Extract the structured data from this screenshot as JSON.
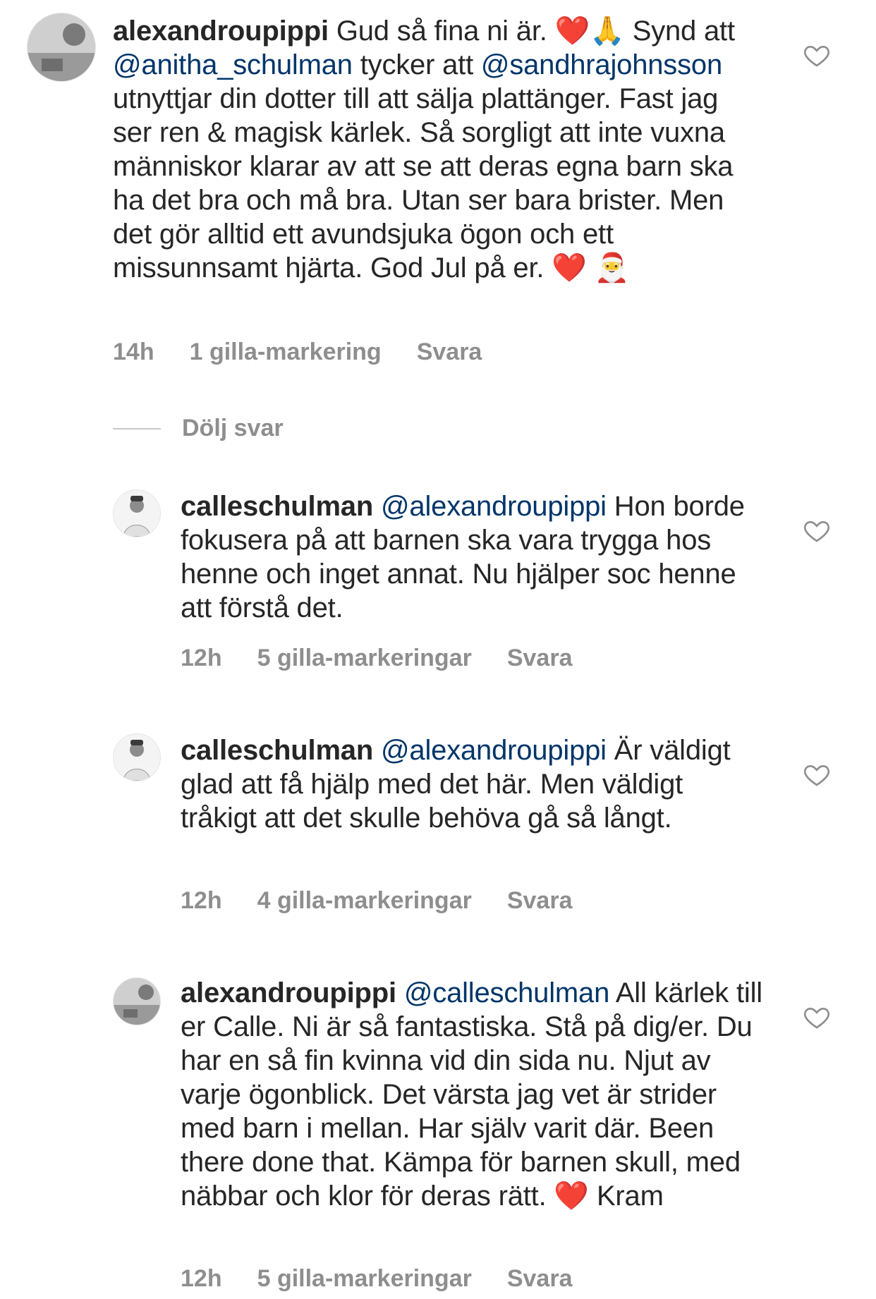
{
  "comments": [
    {
      "username": "alexandroupippi",
      "segments": [
        {
          "t": " Gud så fina ni är. "
        },
        {
          "t": "❤️",
          "emoji": true
        },
        {
          "t": "🙏",
          "emoji": true
        },
        {
          "t": " Synd att "
        },
        {
          "t": "@anitha_schulman",
          "mention": true
        },
        {
          "t": " tycker att "
        },
        {
          "t": "@sandhrajohnsson",
          "mention": true
        },
        {
          "t": " utnyttjar din dotter till att sälja plattänger. Fast jag ser ren & magisk kärlek. Så sorgligt att inte vuxna människor klarar av att se att deras egna barn ska ha det bra och må bra. Utan ser bara brister. Men det gör alltid ett avundsjuka ögon och ett missunnsamt hjärta. God Jul på er. "
        },
        {
          "t": "❤️",
          "emoji": true
        },
        {
          "t": " "
        },
        {
          "t": "🎅",
          "emoji": true
        }
      ],
      "time": "14h",
      "likes": "1 gilla-markering",
      "reply": "Svara"
    },
    {
      "username": "calleschulman",
      "segments": [
        {
          "t": " "
        },
        {
          "t": "@alexandroupippi",
          "mention": true
        },
        {
          "t": " Hon borde fokusera på att barnen ska vara trygga hos henne och inget annat. Nu hjälper soc henne att förstå det."
        }
      ],
      "time": "12h",
      "likes": "5 gilla-markeringar",
      "reply": "Svara"
    },
    {
      "username": "calleschulman",
      "segments": [
        {
          "t": " "
        },
        {
          "t": "@alexandroupippi",
          "mention": true
        },
        {
          "t": " Är väldigt glad att få hjälp med det här. Men väldigt tråkigt att det skulle behöva gå så långt."
        }
      ],
      "time": "12h",
      "likes": "4 gilla-markeringar",
      "reply": "Svara"
    },
    {
      "username": "alexandroupippi",
      "segments": [
        {
          "t": " "
        },
        {
          "t": "@calleschulman",
          "mention": true
        },
        {
          "t": " All kärlek till er Calle. Ni är så fantastiska. Stå på dig/er.  Du har en så fin kvinna vid din sida nu. Njut av varje ögonblick. Det värsta jag vet är strider med barn i mellan. Har själv varit där. Been there done that. Kämpa för barnen skull, med näbbar och klor för deras rätt. "
        },
        {
          "t": "❤️",
          "emoji": true
        },
        {
          "t": " Kram"
        }
      ],
      "time": "12h",
      "likes": "5 gilla-markeringar",
      "reply": "Svara"
    }
  ],
  "hide_replies": "Dölj svar",
  "colors": {
    "text": "#262626",
    "mention": "#003569",
    "meta": "#8e8e8e",
    "heart": "#8e8e8e"
  },
  "icons": {
    "like": "heart-outline-icon"
  }
}
